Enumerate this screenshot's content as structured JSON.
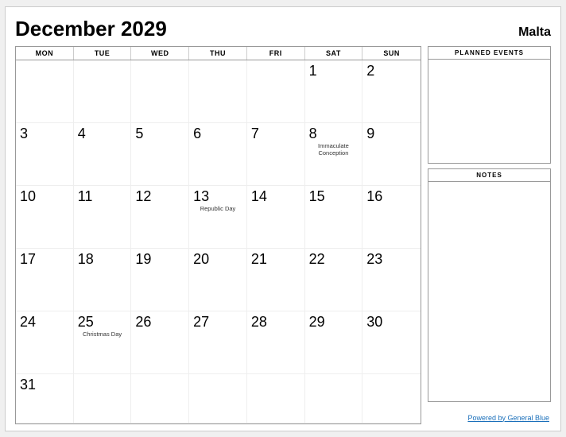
{
  "header": {
    "month_year": "December 2029",
    "country": "Malta"
  },
  "day_headers": [
    "MON",
    "TUE",
    "WED",
    "THU",
    "FRI",
    "SAT",
    "SUN"
  ],
  "weeks": [
    [
      {
        "num": "",
        "event": ""
      },
      {
        "num": "",
        "event": ""
      },
      {
        "num": "",
        "event": ""
      },
      {
        "num": "",
        "event": ""
      },
      {
        "num": "",
        "event": ""
      },
      {
        "num": "1",
        "event": ""
      },
      {
        "num": "2",
        "event": ""
      }
    ],
    [
      {
        "num": "3",
        "event": ""
      },
      {
        "num": "4",
        "event": ""
      },
      {
        "num": "5",
        "event": ""
      },
      {
        "num": "6",
        "event": ""
      },
      {
        "num": "7",
        "event": ""
      },
      {
        "num": "8",
        "event": "Immaculate\nConception"
      },
      {
        "num": "9",
        "event": ""
      }
    ],
    [
      {
        "num": "10",
        "event": ""
      },
      {
        "num": "11",
        "event": ""
      },
      {
        "num": "12",
        "event": ""
      },
      {
        "num": "13",
        "event": "Republic Day"
      },
      {
        "num": "14",
        "event": ""
      },
      {
        "num": "15",
        "event": ""
      },
      {
        "num": "16",
        "event": ""
      }
    ],
    [
      {
        "num": "17",
        "event": ""
      },
      {
        "num": "18",
        "event": ""
      },
      {
        "num": "19",
        "event": ""
      },
      {
        "num": "20",
        "event": ""
      },
      {
        "num": "21",
        "event": ""
      },
      {
        "num": "22",
        "event": ""
      },
      {
        "num": "23",
        "event": ""
      }
    ],
    [
      {
        "num": "24",
        "event": ""
      },
      {
        "num": "25",
        "event": "Christmas Day"
      },
      {
        "num": "26",
        "event": ""
      },
      {
        "num": "27",
        "event": ""
      },
      {
        "num": "28",
        "event": ""
      },
      {
        "num": "29",
        "event": ""
      },
      {
        "num": "30",
        "event": ""
      }
    ],
    [
      {
        "num": "31",
        "event": ""
      },
      {
        "num": "",
        "event": ""
      },
      {
        "num": "",
        "event": ""
      },
      {
        "num": "",
        "event": ""
      },
      {
        "num": "",
        "event": ""
      },
      {
        "num": "",
        "event": ""
      },
      {
        "num": "",
        "event": ""
      }
    ]
  ],
  "sidebar": {
    "planned_events_label": "PLANNED EVENTS",
    "notes_label": "NOTES"
  },
  "footer": {
    "link_text": "Powered by General Blue",
    "link_url": "#"
  }
}
